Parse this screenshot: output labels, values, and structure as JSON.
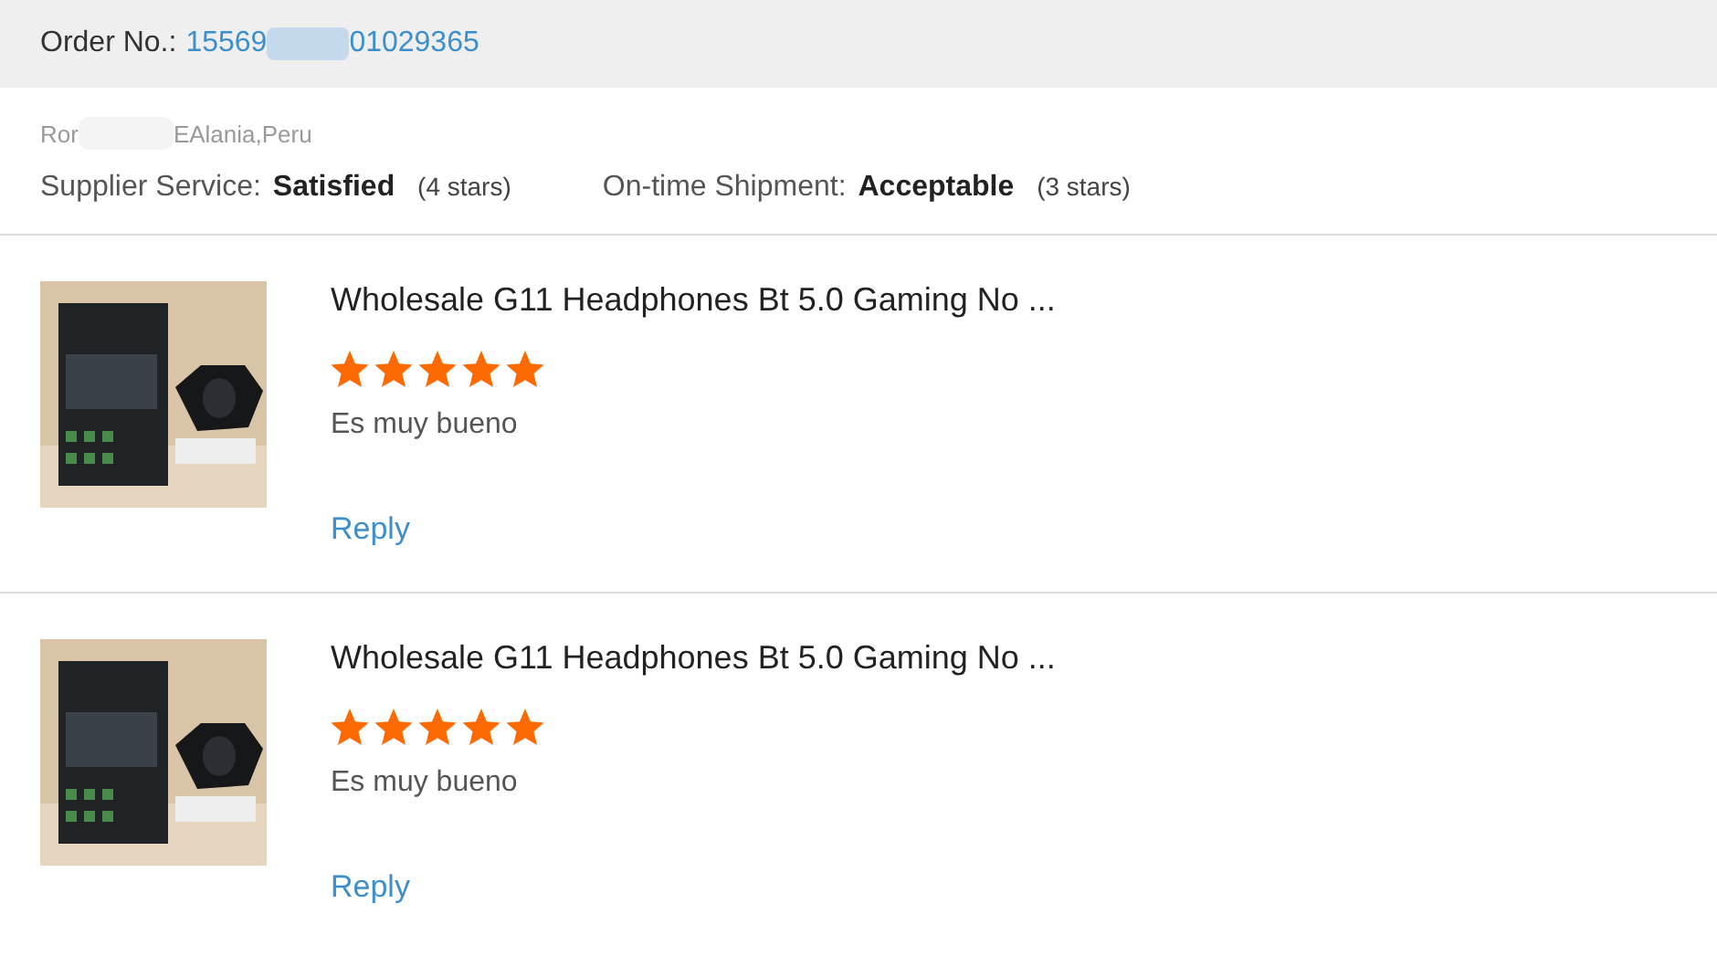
{
  "order": {
    "label": "Order No.:",
    "number_start": "15569",
    "number_end": "01029365"
  },
  "buyer": {
    "name_start": "Ror",
    "name_end": "EAlania,Peru"
  },
  "ratings": [
    {
      "label": "Supplier Service:",
      "value": "Satisfied",
      "note": "(4 stars)"
    },
    {
      "label": "On-time Shipment:",
      "value": "Acceptable",
      "note": "(3 stars)"
    }
  ],
  "reviews": [
    {
      "kind": "picture",
      "title": "Wholesale G11 Headphones Bt 5.0 Gaming No ...",
      "stars": 5,
      "comment": "Es muy bueno",
      "action": "Reply"
    },
    {
      "kind": "picture",
      "title": "Wholesale G11 Headphones Bt 5.0 Gaming No ...",
      "stars": 5,
      "comment": "Es muy bueno",
      "action": "Reply"
    }
  ]
}
